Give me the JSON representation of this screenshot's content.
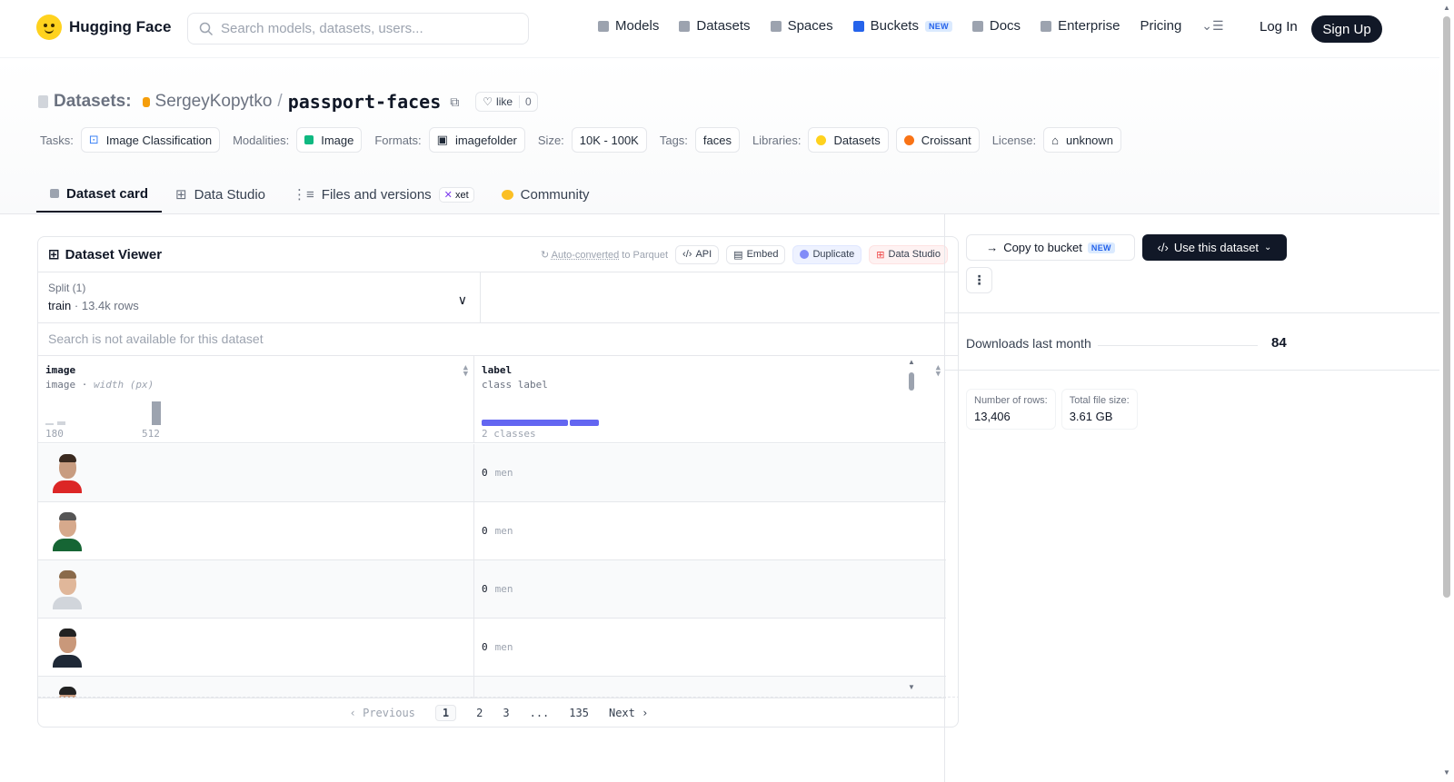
{
  "nav": {
    "brand": "Hugging Face",
    "search_placeholder": "Search models, datasets, users...",
    "items": [
      {
        "label": "Models",
        "icon": "models-icon",
        "color": "#9ca3af"
      },
      {
        "label": "Datasets",
        "icon": "datasets-icon",
        "color": "#9ca3af"
      },
      {
        "label": "Spaces",
        "icon": "spaces-icon",
        "color": "#9ca3af"
      },
      {
        "label": "Buckets",
        "icon": "buckets-icon",
        "color": "#2563eb",
        "badge": "NEW"
      },
      {
        "label": "Docs",
        "icon": "docs-icon",
        "color": "#9ca3af"
      },
      {
        "label": "Enterprise",
        "icon": "enterprise-icon",
        "color": "#9ca3af"
      },
      {
        "label": "Pricing"
      }
    ],
    "login": "Log In",
    "signup": "Sign Up"
  },
  "header": {
    "section_label": "Datasets:",
    "owner": "SergeyKopytko",
    "separator": "/",
    "repo": "passport-faces",
    "like_label": "like",
    "like_count": "0",
    "tags": [
      {
        "label": "Tasks:",
        "values": [
          "Image Classification"
        ]
      },
      {
        "label": "Modalities:",
        "values": [
          "Image"
        ]
      },
      {
        "label": "Formats:",
        "values": [
          "imagefolder"
        ]
      },
      {
        "label": "Size:",
        "values": [
          "10K - 100K"
        ]
      },
      {
        "label": "Tags:",
        "values": [
          "faces"
        ]
      },
      {
        "label": "Libraries:",
        "values": [
          "Datasets",
          "Croissant"
        ]
      },
      {
        "label": "License:",
        "values": [
          "unknown"
        ]
      }
    ]
  },
  "tabs": [
    {
      "label": "Dataset card",
      "active": true
    },
    {
      "label": "Data Studio"
    },
    {
      "label": "Files and versions",
      "badge": "xet"
    },
    {
      "label": "Community"
    }
  ],
  "viewer": {
    "title": "Dataset Viewer",
    "auto_converted": "Auto-converted",
    "auto_suffix": "to Parquet",
    "actions": [
      "API",
      "Embed",
      "Duplicate",
      "Data Studio"
    ],
    "split_label": "Split (1)",
    "split_value": "train",
    "split_rows": "13.4k rows",
    "search_na": "Search is not available for this dataset",
    "columns": [
      {
        "name": "image",
        "type": "image",
        "subtype": "width (px)",
        "hist_min": "180",
        "hist_max": "512"
      },
      {
        "name": "label",
        "type": "class label",
        "classes": "2 classes"
      }
    ],
    "rows": [
      {
        "label_value": "0",
        "label_name": "men"
      },
      {
        "label_value": "0",
        "label_name": "men"
      },
      {
        "label_value": "0",
        "label_name": "men"
      },
      {
        "label_value": "0",
        "label_name": "men"
      }
    ],
    "pager": {
      "prev": "Previous",
      "pages": [
        "1",
        "2",
        "3",
        "...",
        "135"
      ],
      "next": "Next"
    }
  },
  "sidebar": {
    "copy_to_bucket": "Copy to bucket",
    "copy_badge": "NEW",
    "use_dataset": "Use this dataset",
    "more": "⋮",
    "downloads_label": "Downloads last month",
    "downloads_value": "84",
    "stats": [
      {
        "label": "Number of rows:",
        "value": "13,406"
      },
      {
        "label": "Total file size:",
        "value": "3.61 GB"
      }
    ]
  }
}
